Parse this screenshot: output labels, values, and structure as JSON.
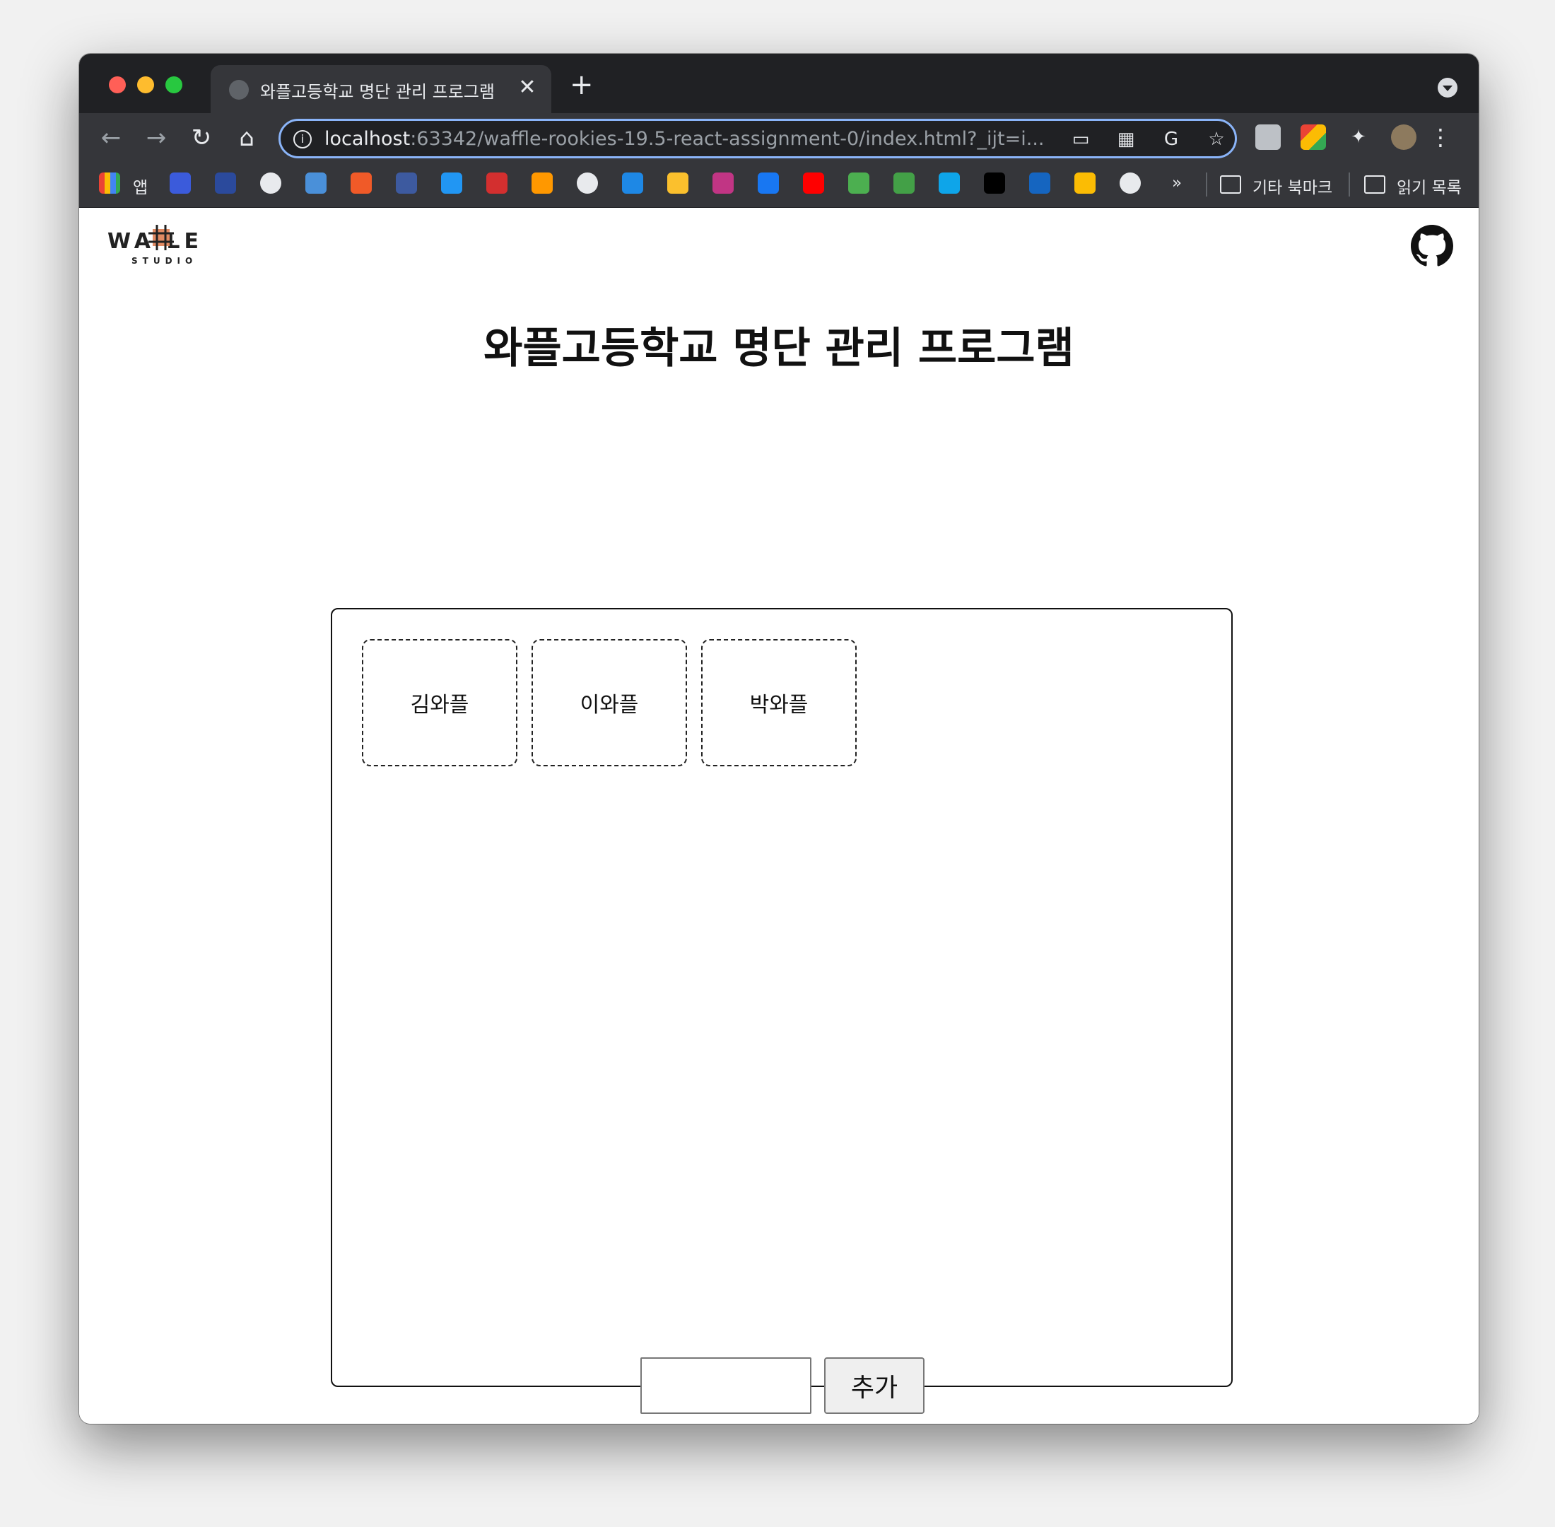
{
  "browser": {
    "tab_title": "와플고등학교 명단 관리 프로그램",
    "tab_close": "✕",
    "new_tab": "+",
    "url_host": "localhost",
    "url_rest": ":63342/waffle-rookies-19.5-react-assignment-0/index.html?_ijt=i...",
    "nav": {
      "back": "←",
      "forward": "→",
      "reload": "↻",
      "home": "⌂"
    },
    "menu": "⋮"
  },
  "bookmarks": {
    "apps_label": "앱",
    "more": "»",
    "other_label": "기타 북마크",
    "reading_label": "읽기 목록",
    "icon_colors": [
      "#3b5bdb",
      "#2b4a9c",
      "#e8eaed",
      "#4a90d9",
      "#f05a28",
      "#3d5a9f",
      "#2196f3",
      "#d32f2f",
      "#ff9800",
      "#e8eaed",
      "#1e88e5",
      "#fbc02d",
      "#c13584",
      "#1877f2",
      "#ff0000",
      "#4caf50",
      "#43a047",
      "#0ea5e9",
      "#000000",
      "#1565c0",
      "#fbbc04",
      "#e8eaed"
    ]
  },
  "page": {
    "logo_text": "WA  LE",
    "logo_sub": "STUDIO",
    "title": "와플고등학교 명단 관리 프로그램",
    "students": [
      {
        "name": "김와플"
      },
      {
        "name": "이와플"
      },
      {
        "name": "박와플"
      }
    ],
    "input_value": "",
    "add_label": "추가"
  }
}
